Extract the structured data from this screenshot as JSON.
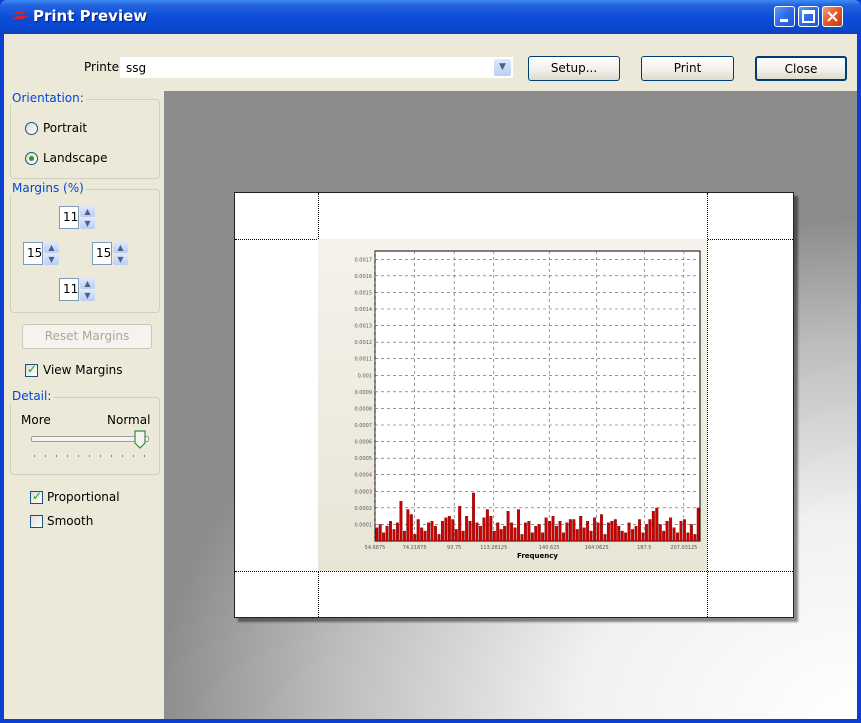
{
  "window": {
    "title": "Print Preview"
  },
  "toolbar": {
    "printer_label": "Printer:",
    "printer_value": "ssg",
    "setup_label": "Setup...",
    "print_label": "Print",
    "close_label": "Close"
  },
  "orientation": {
    "title": "Orientation:",
    "portrait_label": "Portrait",
    "landscape_label": "Landscape",
    "selected": "Landscape"
  },
  "margins": {
    "title": "Margins (%)",
    "top": "11",
    "left": "15",
    "right": "15",
    "bottom": "11",
    "reset_label": "Reset Margins"
  },
  "view_margins": {
    "label": "View Margins",
    "checked": true
  },
  "detail": {
    "title": "Detail:",
    "more_label": "More",
    "normal_label": "Normal",
    "level": 1.0
  },
  "proportional": {
    "label": "Proportional",
    "checked": true
  },
  "smooth": {
    "label": "Smooth",
    "checked": false
  },
  "colors": {
    "titlebar": "#0a4bd8",
    "bars": "#cc0000",
    "group_title": "#0046d5"
  },
  "chart_data": {
    "type": "bar",
    "xlabel": "Frequency",
    "ylabel": "",
    "title": "",
    "y_ticks": [
      "0.0001",
      "0.0002",
      "0.0003",
      "0.0004",
      "0.0005",
      "0.0006",
      "0.0007",
      "0.0008",
      "0.0009",
      "0.001",
      "0.0011",
      "0.0012",
      "0.0013",
      "0.0014",
      "0.0015",
      "0.0016",
      "0.0017"
    ],
    "x_ticks": [
      "54.6875",
      "74.21875",
      "93.75",
      "113.28125",
      "140.625",
      "164.0625",
      "187.5",
      "207.03125"
    ],
    "ylim": [
      0,
      0.00175
    ],
    "xlim": [
      54.6875,
      215
    ],
    "grid": true,
    "values": [
      8e-05,
      0.0001,
      5e-05,
      9e-05,
      0.00012,
      7e-05,
      0.00011,
      0.00024,
      6e-05,
      0.00019,
      0.00016,
      4e-05,
      0.00013,
      8e-05,
      6e-05,
      0.00011,
      0.00012,
      9e-05,
      4e-05,
      0.00012,
      0.00014,
      0.00015,
      0.00013,
      7e-05,
      0.00021,
      6e-05,
      0.00015,
      0.00012,
      0.00029,
      0.00011,
      9e-05,
      0.00014,
      0.00019,
      0.00015,
      6e-05,
      0.00011,
      7e-05,
      9e-05,
      0.00018,
      0.00011,
      8e-05,
      0.00019,
      4e-05,
      0.00011,
      0.00012,
      5e-05,
      9e-05,
      0.0001,
      5e-05,
      0.00014,
      0.00012,
      0.00015,
      9e-05,
      0.00012,
      5e-05,
      0.00011,
      0.00013,
      0.00013,
      7e-05,
      0.00015,
      8e-05,
      0.00012,
      6e-05,
      0.00014,
      0.00011,
      0.00016,
      4e-05,
      0.00011,
      0.00012,
      0.00013,
      9e-05,
      6e-05,
      5e-05,
      0.00011,
      7e-05,
      9e-05,
      0.00013,
      5e-05,
      0.0001,
      0.00013,
      0.00018,
      0.0002,
      0.0001,
      6e-05,
      0.00012,
      0.00014,
      8e-05,
      5e-05,
      0.00012,
      0.00013,
      5e-05,
      0.0001,
      4e-05,
      0.0002
    ]
  }
}
